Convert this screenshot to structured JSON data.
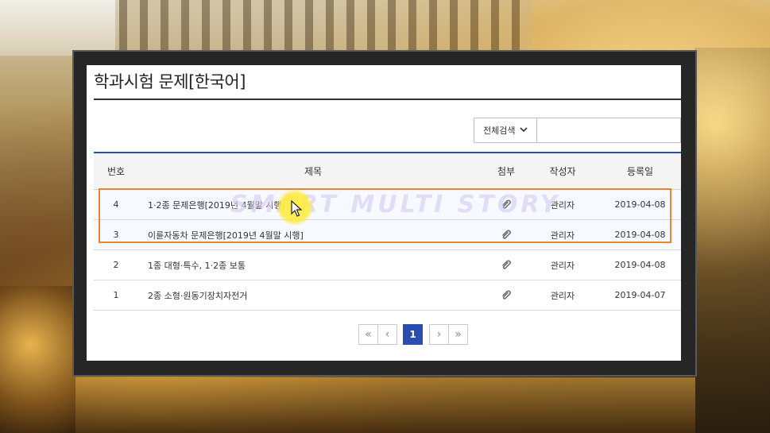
{
  "page": {
    "title": "학과시험 문제[한국어]"
  },
  "search": {
    "scope_label": "전체검색",
    "query_value": ""
  },
  "table": {
    "headers": {
      "num": "번호",
      "title": "제목",
      "attach": "첨부",
      "author": "작성자",
      "date": "등록일"
    },
    "rows": [
      {
        "num": "4",
        "title": "1·2종 문제은행[2019년 4월말 시행]",
        "author": "관리자",
        "date": "2019-04-08"
      },
      {
        "num": "3",
        "title": "이륜자동차 문제은행[2019년 4월말 시행]",
        "author": "관리자",
        "date": "2019-04-08"
      },
      {
        "num": "2",
        "title": "1종 대형·특수, 1·2종 보통",
        "author": "관리자",
        "date": "2019-04-08"
      },
      {
        "num": "1",
        "title": "2종 소형·원동기장치자전거",
        "author": "관리자",
        "date": "2019-04-07"
      }
    ]
  },
  "pagination": {
    "first": "«",
    "prev": "‹",
    "current": "1",
    "next": "›",
    "last": "»"
  },
  "overlay": {
    "watermark": "SMART MULTI STORY"
  },
  "colors": {
    "accent": "#2a4db0",
    "highlight_box": "#e8832e",
    "cursor_glow": "#ffeb3c"
  },
  "icons": {
    "attachment": "paperclip-icon",
    "dropdown": "chevron-down-icon"
  }
}
